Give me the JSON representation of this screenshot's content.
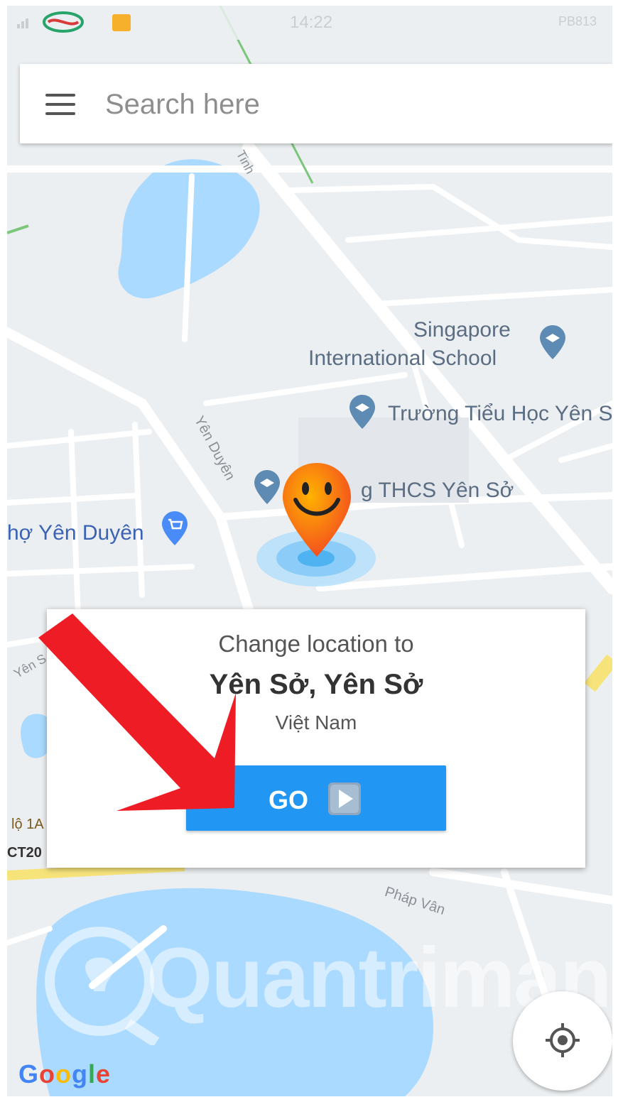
{
  "status_bar": {
    "time": "14:22",
    "battery": "PB813"
  },
  "search": {
    "menu_icon": "hamburger-menu-icon",
    "placeholder": "Search here"
  },
  "map": {
    "road_labels": [
      "Tinh",
      "Yên Duyên",
      "Yên S",
      "Pháp Vân",
      "lộ 1A",
      "CT20"
    ],
    "poi_labels": [
      "Singapore",
      "International School",
      "Trường Tiểu Học Yên S",
      "g THCS Yên Sở",
      "hợ Yên Duyên"
    ]
  },
  "dialog": {
    "title": "Change location to",
    "place": "Yên Sở, Yên Sở",
    "country": "Việt Nam",
    "go_label": "GO",
    "go_icon": "play-icon"
  },
  "brand": {
    "google": "Google",
    "watermark": "Quantrimang"
  },
  "colors": {
    "accent": "#2196f3",
    "water": "#aadaff",
    "pin": "#ff8f00",
    "arrow": "#ee1c24"
  }
}
